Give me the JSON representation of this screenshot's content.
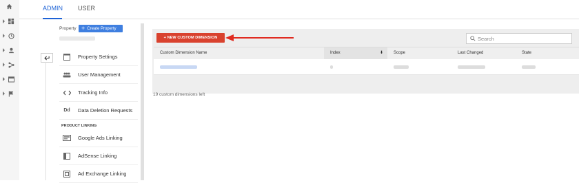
{
  "tabs": [
    {
      "label": "ADMIN",
      "active": true
    },
    {
      "label": "USER",
      "active": false
    }
  ],
  "rail": {
    "icons": [
      "home-icon",
      "dashboard-icon",
      "clock-icon",
      "person-icon",
      "acquisition-icon",
      "behavior-icon",
      "flag-icon"
    ]
  },
  "property": {
    "label": "Property",
    "create_button": "Create Property"
  },
  "menu": {
    "items": [
      {
        "label": "Property Settings",
        "icon": "settings-window-icon"
      },
      {
        "label": "User Management",
        "icon": "users-icon"
      },
      {
        "label": "Tracking Info",
        "icon": "code-icon"
      },
      {
        "label": "Data Deletion Requests",
        "icon": "dd-icon"
      }
    ],
    "section_label": "PRODUCT LINKING",
    "linking_items": [
      {
        "label": "Google Ads Linking",
        "icon": "ads-icon"
      },
      {
        "label": "AdSense Linking",
        "icon": "adsense-icon"
      },
      {
        "label": "Ad Exchange Linking",
        "icon": "adexchange-icon"
      }
    ]
  },
  "main": {
    "new_button": "+ NEW CUSTOM DIMENSION",
    "search_placeholder": "Search",
    "columns": [
      "Custom Dimension Name",
      "Index",
      "Scope",
      "Last Changed",
      "State"
    ],
    "sorted_column": "Index",
    "footer_text": "19 custom dimensions left"
  },
  "colors": {
    "accent": "#1e63d6",
    "danger_button": "#d9422e",
    "arrow": "#e02b20"
  }
}
